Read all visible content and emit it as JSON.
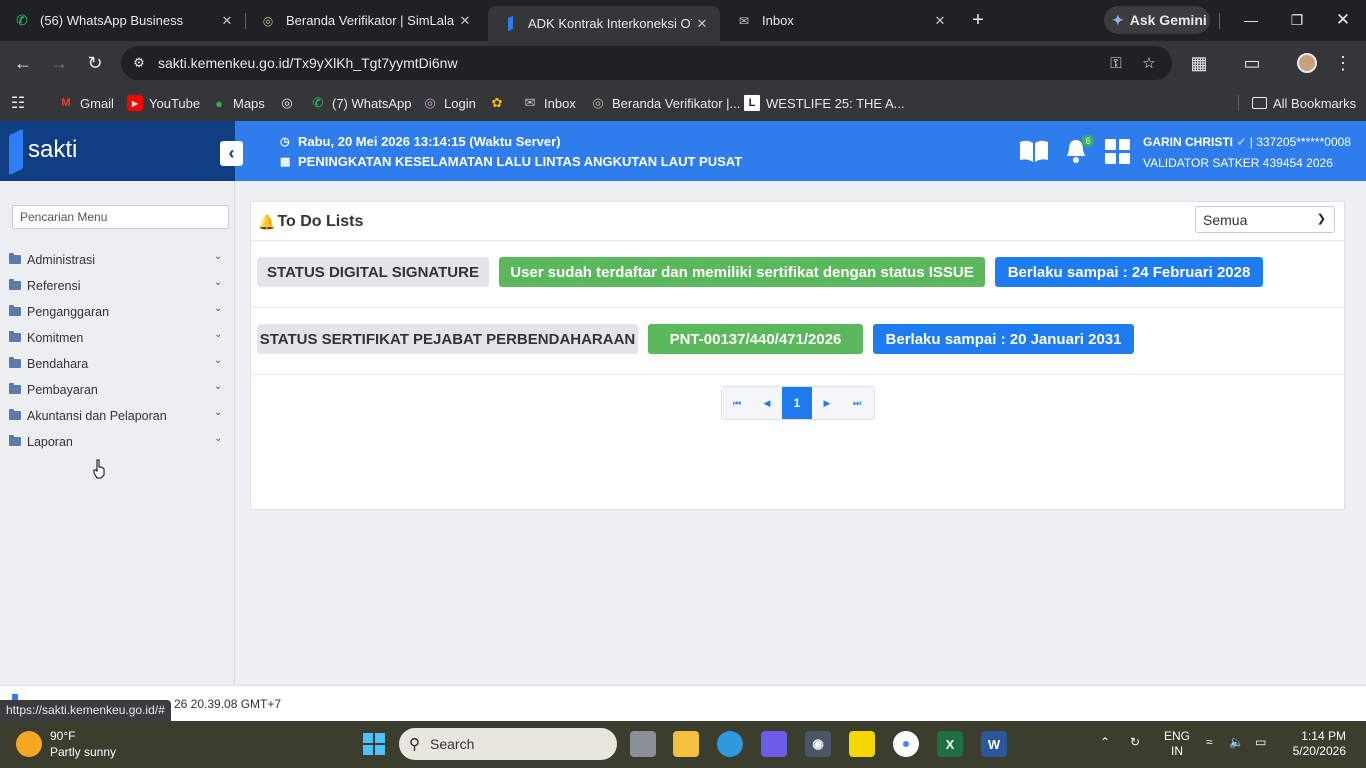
{
  "browser": {
    "tabs": [
      {
        "title": "(56) WhatsApp Business",
        "icon": "whatsapp-icon"
      },
      {
        "title": "Beranda Verifikator | SimLala",
        "icon": "globe-icon"
      },
      {
        "title": "ADK Kontrak Interkoneksi OTP P",
        "icon": "sakti-icon",
        "active": true
      },
      {
        "title": "Inbox",
        "icon": "mail-icon"
      }
    ],
    "ask_gemini": "Ask Gemini",
    "url": "sakti.kemenkeu.go.id/Tx9yXlKh_Tgt7yymtDi6nw",
    "bookmarks": [
      "Gmail",
      "YouTube",
      "Maps",
      "(7) WhatsApp",
      "Login",
      "Inbox",
      "Beranda Verifikator |...",
      "WESTLIFE 25: THE A..."
    ],
    "all_bookmarks": "All Bookmarks"
  },
  "app": {
    "brand": "sakti",
    "header": {
      "datetime": "Rabu, 20 Mei 2026 13:14:15 (Waktu Server)",
      "unit": "PENINGKATAN KESELAMATAN LALU LINTAS ANGKUTAN LAUT PUSAT",
      "notif_count": "6",
      "user_name": "GARIN CHRISTI",
      "user_nip": "| 337205******0008",
      "user_role": "VALIDATOR SATKER 439454 2026"
    },
    "sidebar": {
      "search_placeholder": "Pencarian Menu",
      "items": [
        "Administrasi",
        "Referensi",
        "Penganggaran",
        "Komitmen",
        "Bendahara",
        "Pembayaran",
        "Akuntansi dan Pelaporan",
        "Laporan"
      ]
    },
    "todo": {
      "title": "To Do Lists",
      "filter": "Semua",
      "rows": [
        {
          "label": "STATUS DIGITAL SIGNATURE",
          "status": "User sudah terdaftar dan memiliki sertifikat dengan status ISSUE",
          "valid": "Berlaku sampai : 24 Februari 2028"
        },
        {
          "label": "STATUS SERTIFIKAT PEJABAT PERBENDAHARAAN",
          "status": "PNT-00137/440/471/2026",
          "valid": "Berlaku sampai : 20 Januari 2031"
        }
      ],
      "pager": {
        "current": "1"
      }
    },
    "footer_text": "26 20.39.08 GMT+7",
    "hover_url": "https://sakti.kemenkeu.go.id/#"
  },
  "taskbar": {
    "weather_temp": "90°F",
    "weather_cond": "Partly sunny",
    "search_placeholder": "Search",
    "lang_line1": "ENG",
    "lang_line2": "IN",
    "time": "1:14 PM",
    "date": "5/20/2026"
  },
  "colors": {
    "brand_dark": "#0f3e83",
    "header_blue": "#2f7ded",
    "badge_green": "#5cb85c",
    "badge_blue": "#1f7cf0"
  }
}
